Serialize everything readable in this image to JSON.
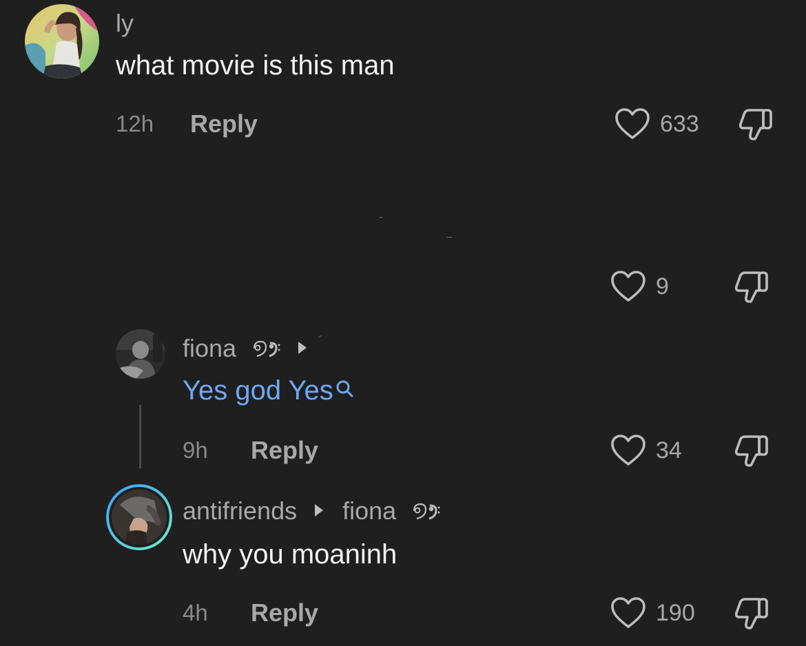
{
  "comments": [
    {
      "username": "ly",
      "text": "what movie is this man",
      "time": "12h",
      "reply_label": "Reply",
      "likes": "633",
      "avatar_icon": "user-avatar-icon"
    },
    {
      "likes": "9"
    },
    {
      "username": "fiona",
      "text": "Yes god Yes",
      "time": "9h",
      "reply_label": "Reply",
      "likes": "34",
      "badge_icon": "bass-clef-emoji-icon"
    },
    {
      "username": "antifriends",
      "reply_to": "fiona",
      "text": "why you moaninh",
      "time": "4h",
      "reply_label": "Reply",
      "likes": "190",
      "badge_icon": "bass-clef-emoji-icon"
    }
  ],
  "colors": {
    "background": "#1f1f1f",
    "link_blue": "#6fa8f5",
    "muted_text": "#a8a8a8",
    "story_ring_start": "#3aa0ff",
    "story_ring_end": "#6ef0c0"
  }
}
